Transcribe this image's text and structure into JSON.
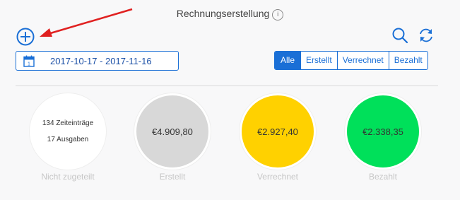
{
  "header": {
    "title": "Rechnungserstellung",
    "info_glyph": "i"
  },
  "icons": {
    "add": "plus-circle-icon",
    "search": "search-icon",
    "refresh": "refresh-icon",
    "calendar": "calendar-icon",
    "calendar_day": "1"
  },
  "date_range": {
    "value": "2017-10-17 - 2017-11-16"
  },
  "filter": {
    "options": [
      "Alle",
      "Erstellt",
      "Verrechnet",
      "Bezahlt"
    ],
    "selected": "Alle"
  },
  "summary": [
    {
      "line1": "134 Zeiteinträge",
      "line2": "17 Ausgaben",
      "label": "Nicht zugeteilt",
      "color": "#ffffff"
    },
    {
      "value": "€4.909,80",
      "label": "Erstellt",
      "color": "#d8d8d8"
    },
    {
      "value": "€2.927,40",
      "label": "Verrechnet",
      "color": "#ffd100"
    },
    {
      "value": "€2.338,35",
      "label": "Bezahlt",
      "color": "#00e05a"
    }
  ],
  "colors": {
    "accent": "#1a6fd6",
    "annotation_arrow": "#e02020"
  }
}
